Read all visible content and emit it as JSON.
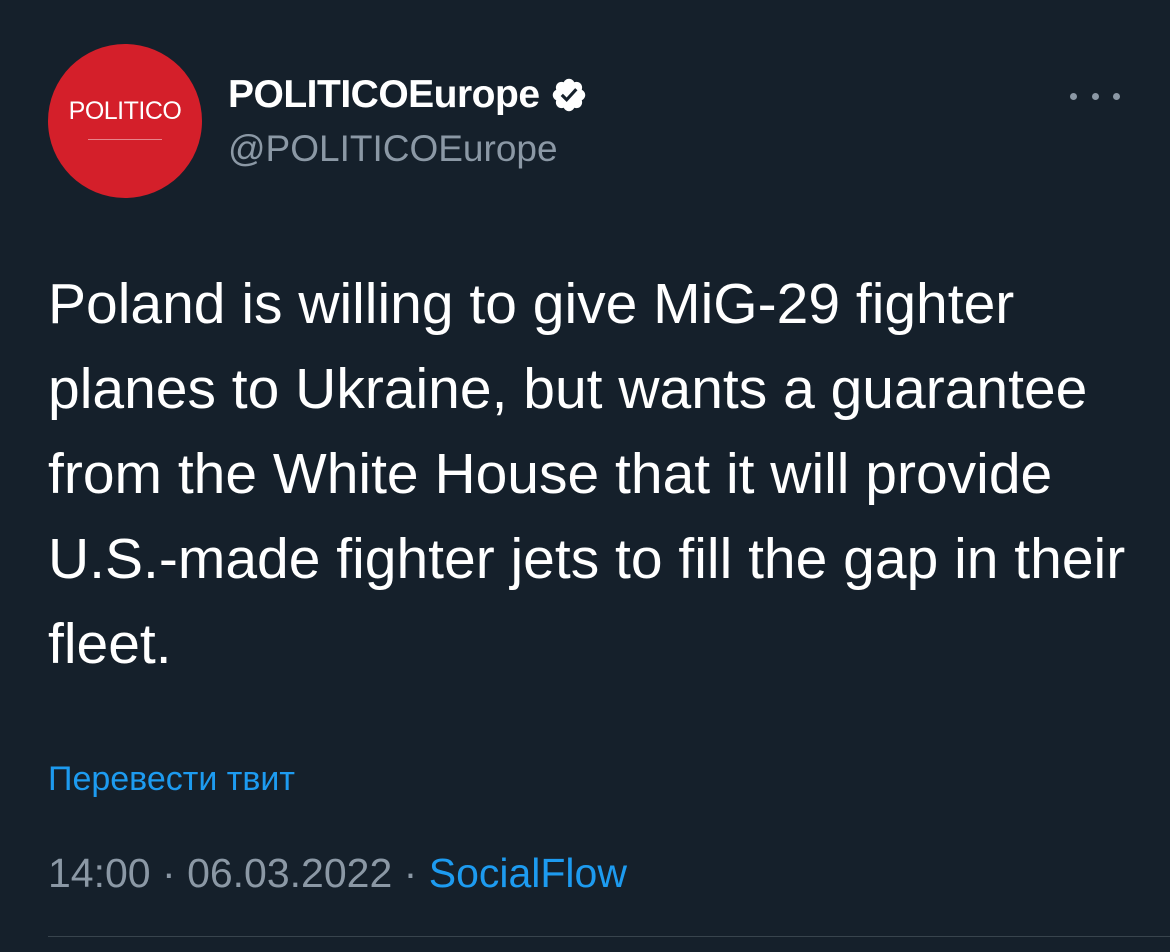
{
  "author": {
    "avatar_logo_text": "POLITICO",
    "display_name": "POLITICOEurope",
    "handle": "@POLITICOEurope",
    "verified_icon": "verified-badge-icon"
  },
  "tweet": {
    "text": "Poland is willing to give MiG-29 fighter planes to Ukraine, but wants a guarantee from the White House that it will provide U.S.-made fighter jets to fill the gap in their fleet.",
    "translate_label": "Перевести твит",
    "time": "14:00",
    "separator": "·",
    "date": "06.03.2022",
    "source": "SocialFlow"
  },
  "menu": {
    "more_icon": "more-options-icon"
  },
  "colors": {
    "background": "#15202b",
    "avatar_red": "#d41f2a",
    "link_blue": "#1d9bf0",
    "muted_gray": "#8b98a5"
  }
}
